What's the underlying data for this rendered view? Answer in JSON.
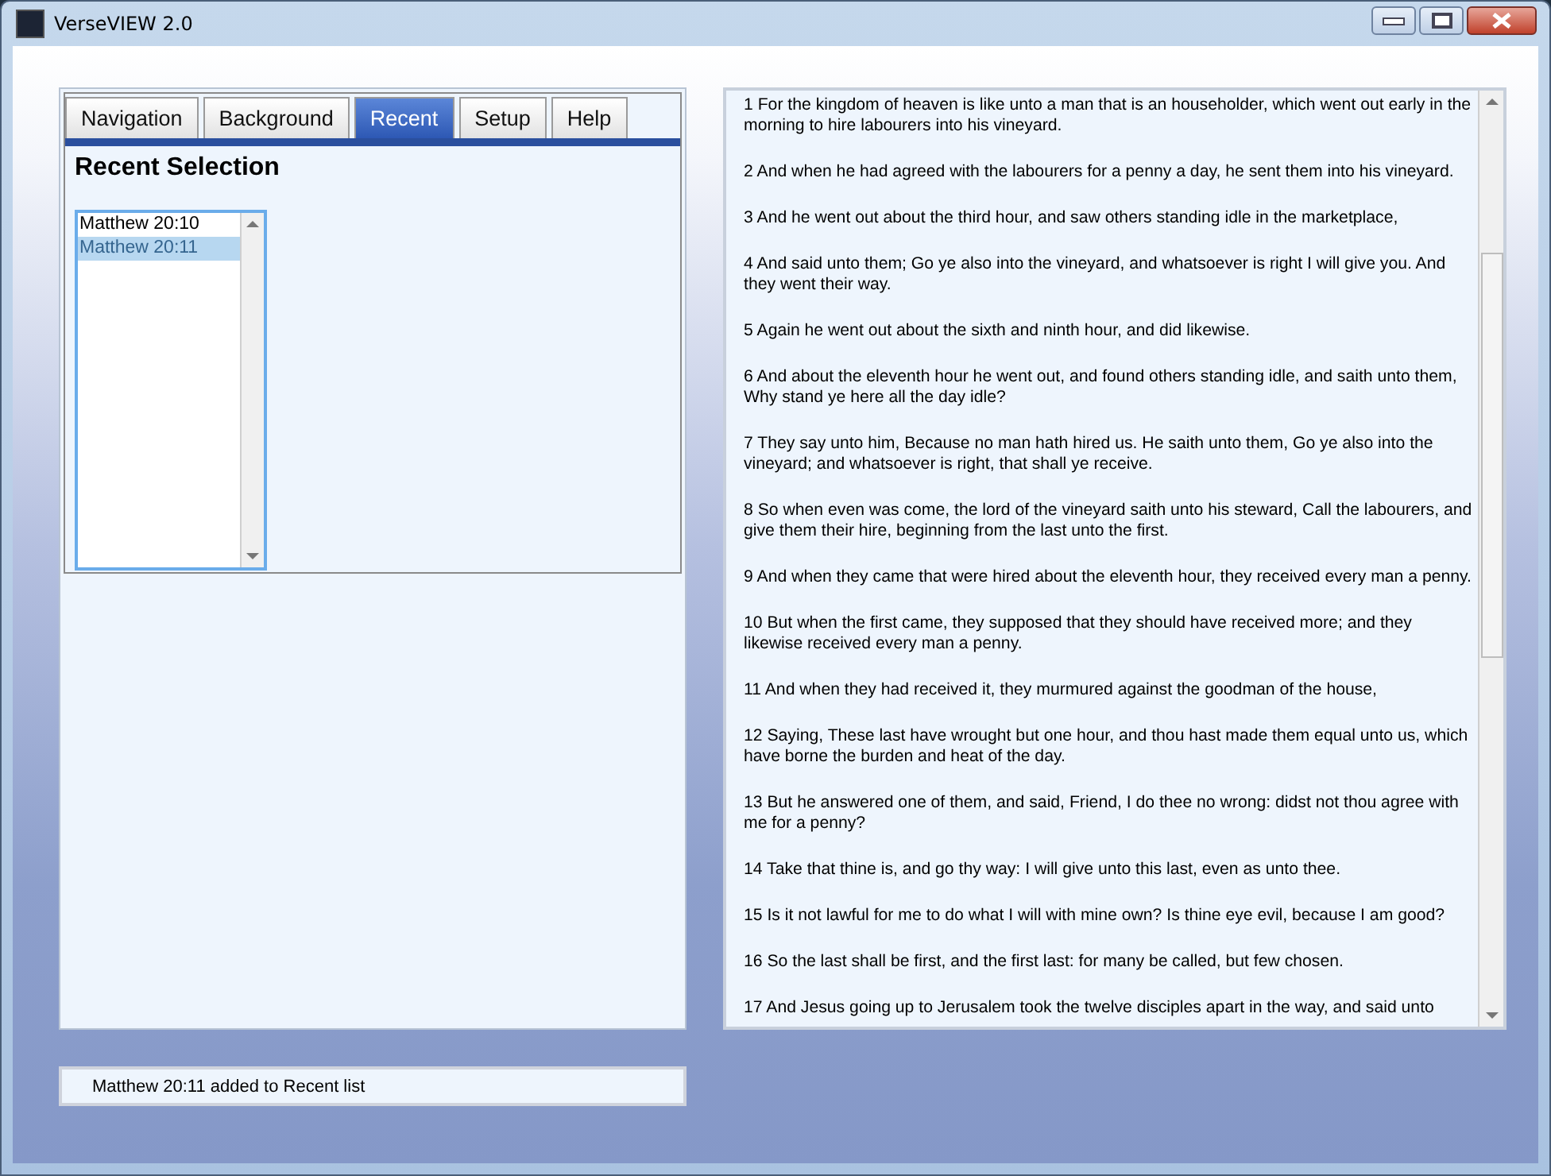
{
  "window": {
    "title": "VerseVIEW 2.0"
  },
  "tabs": [
    {
      "label": "Navigation",
      "selected": false
    },
    {
      "label": "Background",
      "selected": false
    },
    {
      "label": "Recent",
      "selected": true
    },
    {
      "label": "Setup",
      "selected": false
    },
    {
      "label": "Help",
      "selected": false
    }
  ],
  "recent": {
    "heading": "Recent Selection",
    "items": [
      {
        "label": "Matthew 20:10",
        "selected": false
      },
      {
        "label": "Matthew 20:11",
        "selected": true
      }
    ]
  },
  "status_bar": {
    "message": "Matthew 20:11 added to Recent list"
  },
  "verses": [
    "1 For the kingdom of heaven is like unto a man that is an householder, which went out early in the morning to hire labourers into his vineyard.",
    "2 And when he had agreed with the labourers for a penny a day, he sent them into his vineyard.",
    "3 And he went out about the third hour, and saw others standing idle in the marketplace,",
    "4 And said unto them; Go ye also into the vineyard, and whatsoever is right I will give you. And they went their way.",
    "5 Again he went out about the sixth and ninth hour, and did likewise.",
    "6 And about the eleventh hour he went out, and found others standing idle, and saith unto them, Why stand ye here all the day idle?",
    "7 They say unto him, Because no man hath hired us. He saith unto them, Go ye also into the vineyard; and whatsoever is right, that shall ye receive.",
    "8 So when even was come, the lord of the vineyard saith unto his steward, Call the labourers, and give them their hire, beginning from the last unto the first.",
    "9 And when they came that were hired about the eleventh hour, they received every man a penny.",
    "10 But when the first came, they supposed that they should have received more; and they likewise received every man a penny.",
    "11 And when they had received it, they murmured against the goodman of the house,",
    "12 Saying, These last have wrought but one hour, and thou hast made them equal unto us, which have borne the burden and heat of the day.",
    "13 But he answered one of them, and said, Friend, I do thee no wrong: didst not thou agree with me for a penny?",
    "14 Take that thine is, and go thy way: I will give unto this last, even as unto thee.",
    "15 Is it not lawful for me to do what I will with mine own? Is thine eye evil, because I am good?",
    "16 So the last shall be first, and the first last: for many be called, but few chosen.",
    "17 And Jesus going up to Jerusalem took the twelve disciples apart in the way, and said unto"
  ]
}
